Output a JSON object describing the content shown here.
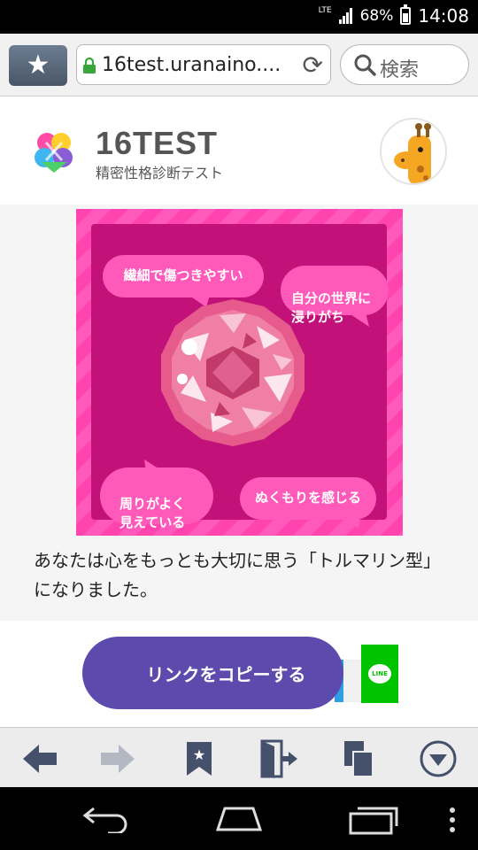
{
  "status_bar": {
    "network": "LTE",
    "battery_percent": "68%",
    "time": "14:08"
  },
  "browser": {
    "url": "16test.uranaino....",
    "search_placeholder": "検索"
  },
  "site": {
    "title": "16TEST",
    "subtitle": "精密性格診断テスト"
  },
  "hero": {
    "bubbles": [
      "繊細で傷つきやすい",
      "自分の世界に\n浸りがち",
      "周りがよく\n見えている",
      "ぬくもりを感じる"
    ]
  },
  "result": {
    "text": "あなたは心をもっとも大切に思う「トルマリン型」になりました。"
  },
  "share": {
    "copy_link_label": "リンクをコピーする",
    "line_label": "LINE"
  },
  "colors": {
    "hero_border": "#ff44b0",
    "hero_inner": "#c2127a",
    "bubble": "#ff5aba",
    "copy_button": "#5d4aad",
    "line_green": "#00c300"
  },
  "icons": {
    "browser_bottom": [
      "back-arrow-icon",
      "forward-arrow-icon",
      "bookmark-icon",
      "exit-icon",
      "tabs-icon",
      "menu-down-icon"
    ],
    "system_nav": [
      "back-icon",
      "home-icon",
      "recent-apps-icon",
      "overflow-menu-icon"
    ]
  }
}
